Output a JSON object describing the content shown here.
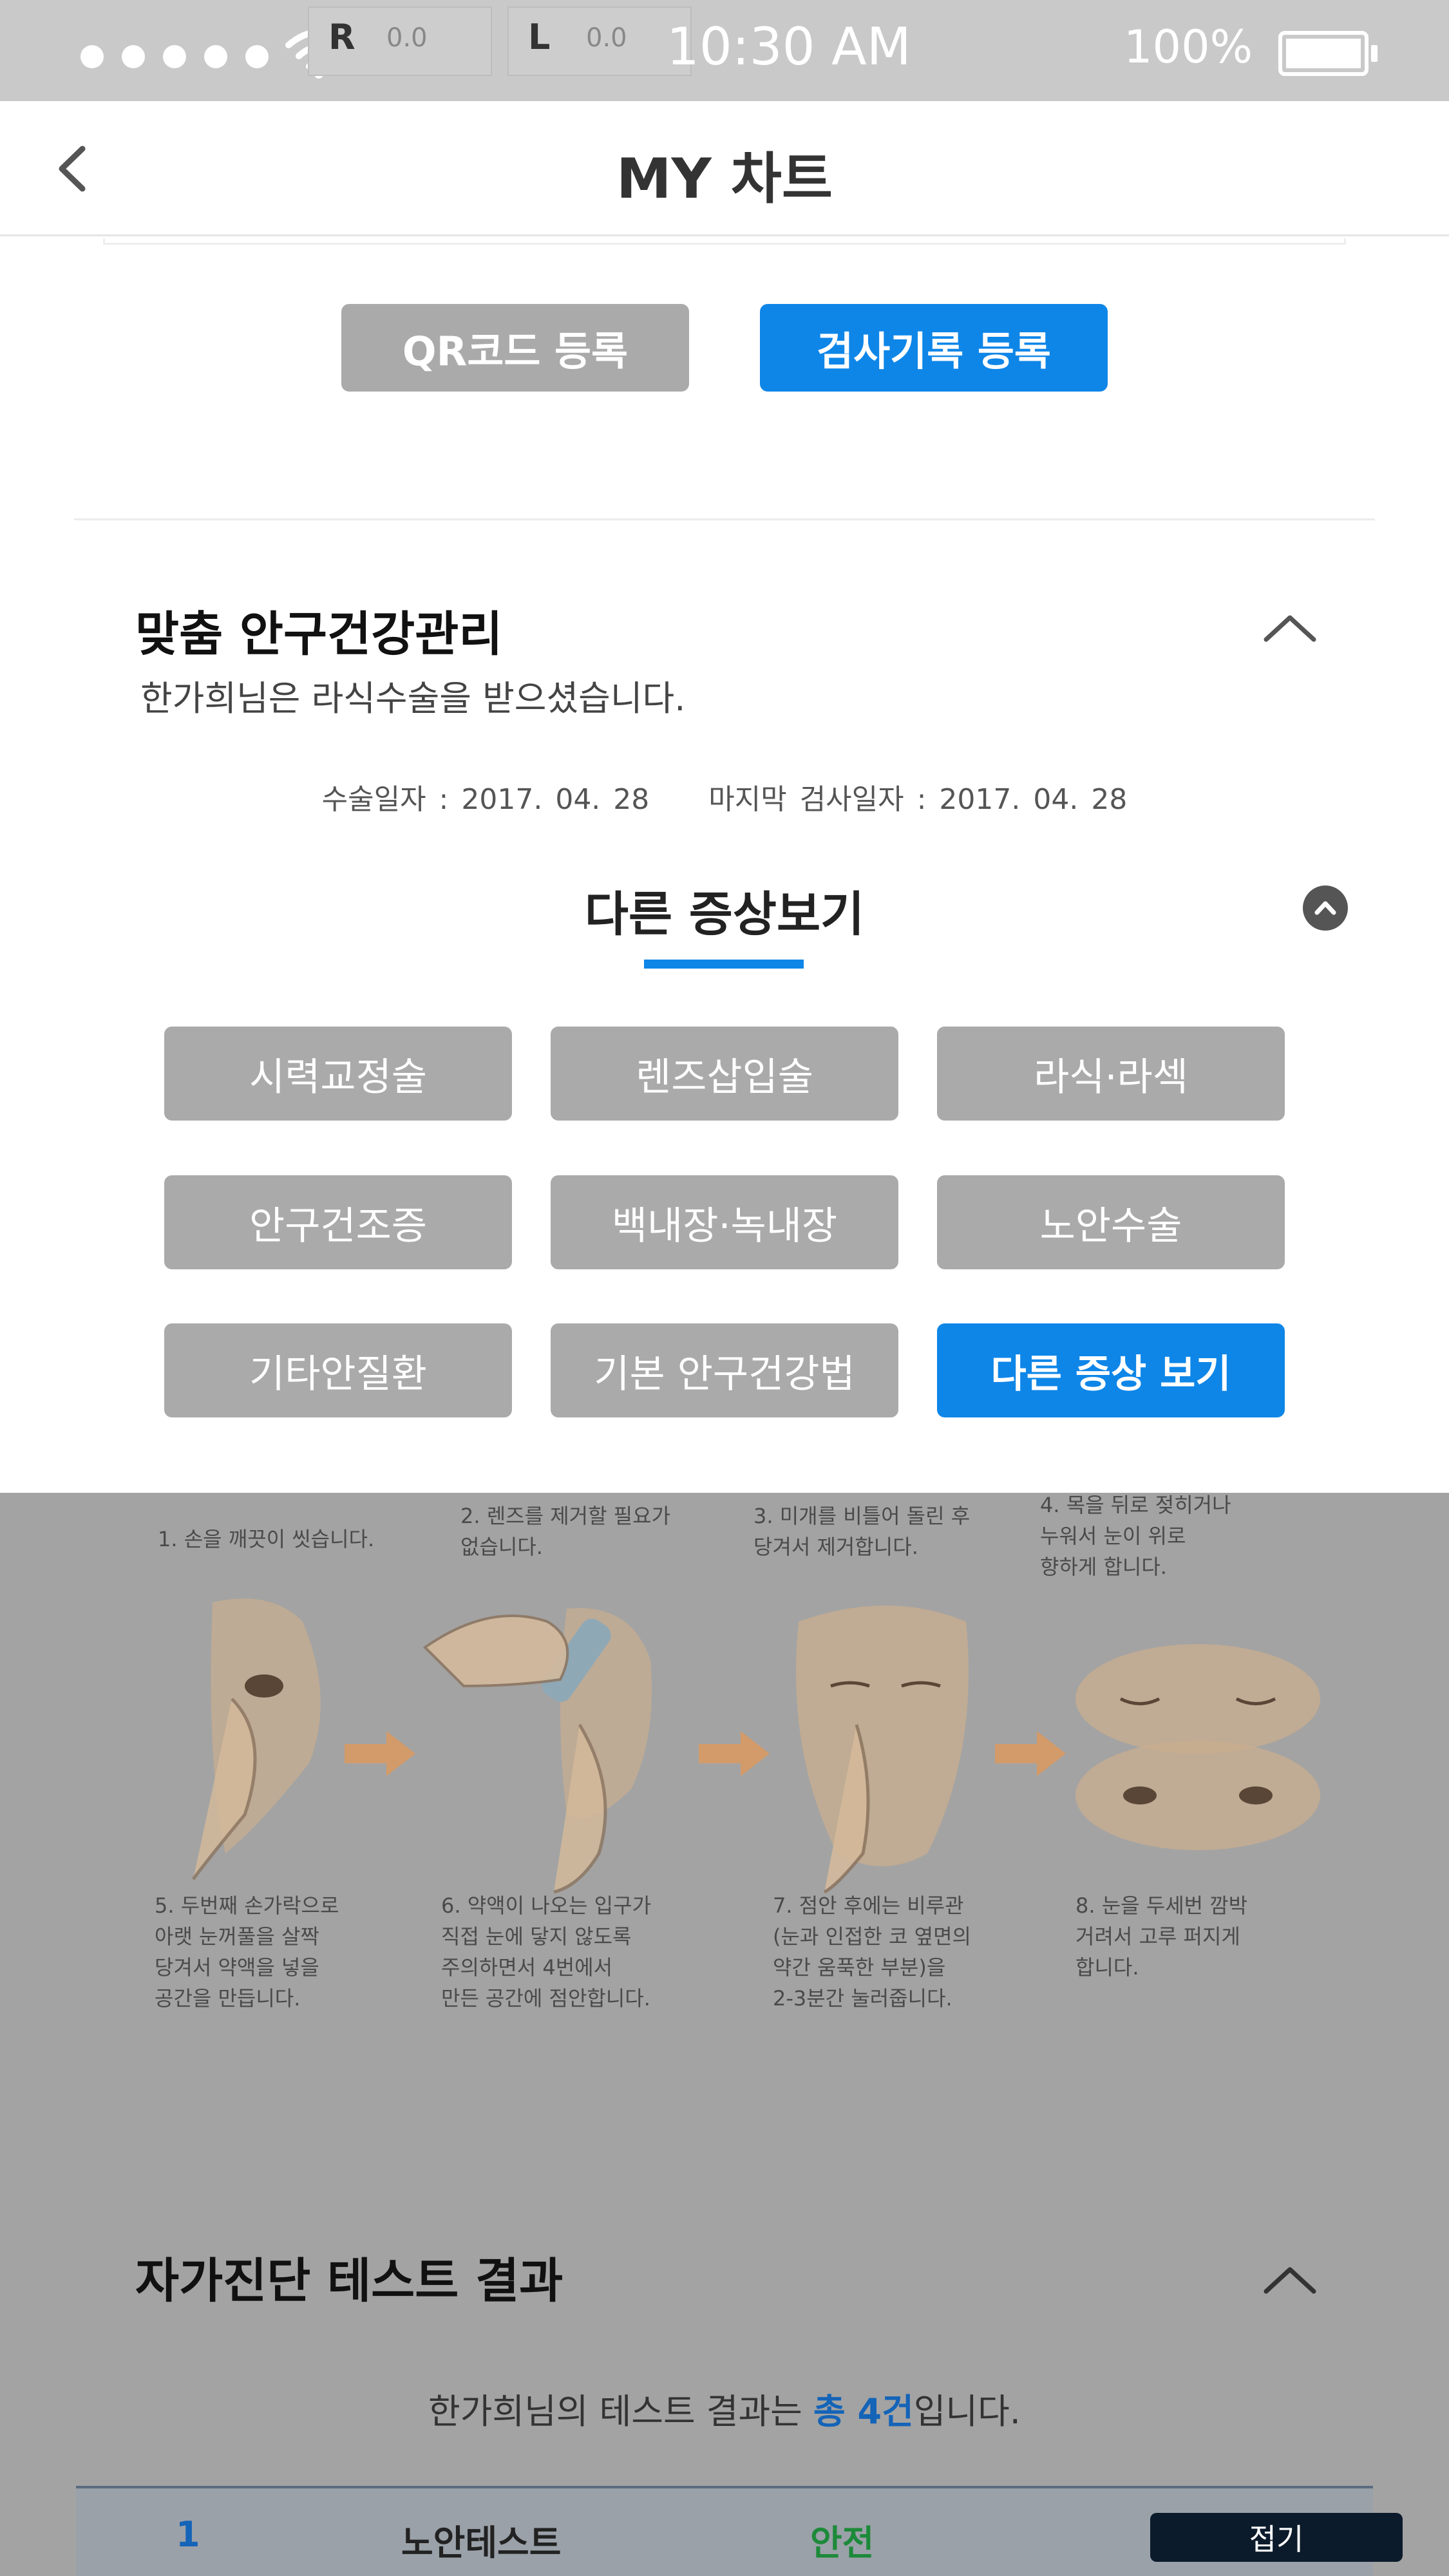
{
  "status_bar": {
    "meter_left_label": "R",
    "meter_left_value": "0.0",
    "meter_right_label": "L",
    "meter_right_value": "0.0",
    "time": "10:30 AM",
    "battery": "100%"
  },
  "header": {
    "title": "MY 차트"
  },
  "actions": {
    "qr_register": "QR코드 등록",
    "record_register": "검사기록 등록"
  },
  "eye_care": {
    "title": "맞춤 안구건강관리",
    "description": "한가희님은 라식수술을 받으셨습니다.",
    "surgery_date_label": "수술일자 : 2017. 04. 28",
    "last_exam_label": "마지막 검사일자 : 2017. 04. 28"
  },
  "other_symptoms": {
    "title": "다른 증상보기",
    "buttons": [
      "시력교정술",
      "렌즈삽입술",
      "라식·라섹",
      "안구건조증",
      "백내장·녹내장",
      "노안수술",
      "기타안질환",
      "기본 안구건강법",
      "다른 증상 보기"
    ]
  },
  "instructions": [
    "1. 손을 깨끗이 씻습니다.",
    "2. 렌즈를 제거할 필요가\n없습니다.",
    "3. 미개를 비틀어 돌린 후\n당겨서 제거합니다.",
    "4. 목을 뒤로 젖히거나\n누워서 눈이 위로\n향하게 합니다.",
    "5. 두번째 손가락으로\n아랫 눈꺼풀을 살짝\n당겨서 약액을 넣을\n공간을 만듭니다.",
    "6. 약액이 나오는 입구가\n직접 눈에 닿지 않도록\n주의하면서 4번에서\n만든 공간에 점안합니다.",
    "7. 점안 후에는 비루관\n(눈과 인접한 코 옆면의\n약간 움푹한 부분)을\n2-3분간 눌러줍니다.",
    "8. 눈을 두세번 깜박\n거려서 고루 퍼지게\n합니다."
  ],
  "self_test": {
    "title": "자가진단 테스트 결과",
    "summary_prefix": "한가희님의 테스트 결과는 ",
    "summary_highlight": "총 4건",
    "summary_suffix": "입니다.",
    "row": {
      "index": "1",
      "name": "노안테스트",
      "status": "안전",
      "action": "접기"
    }
  },
  "colors": {
    "accent": "#0e86e8",
    "button_gray": "#aaaaaa",
    "safe": "#1d8a3a"
  }
}
